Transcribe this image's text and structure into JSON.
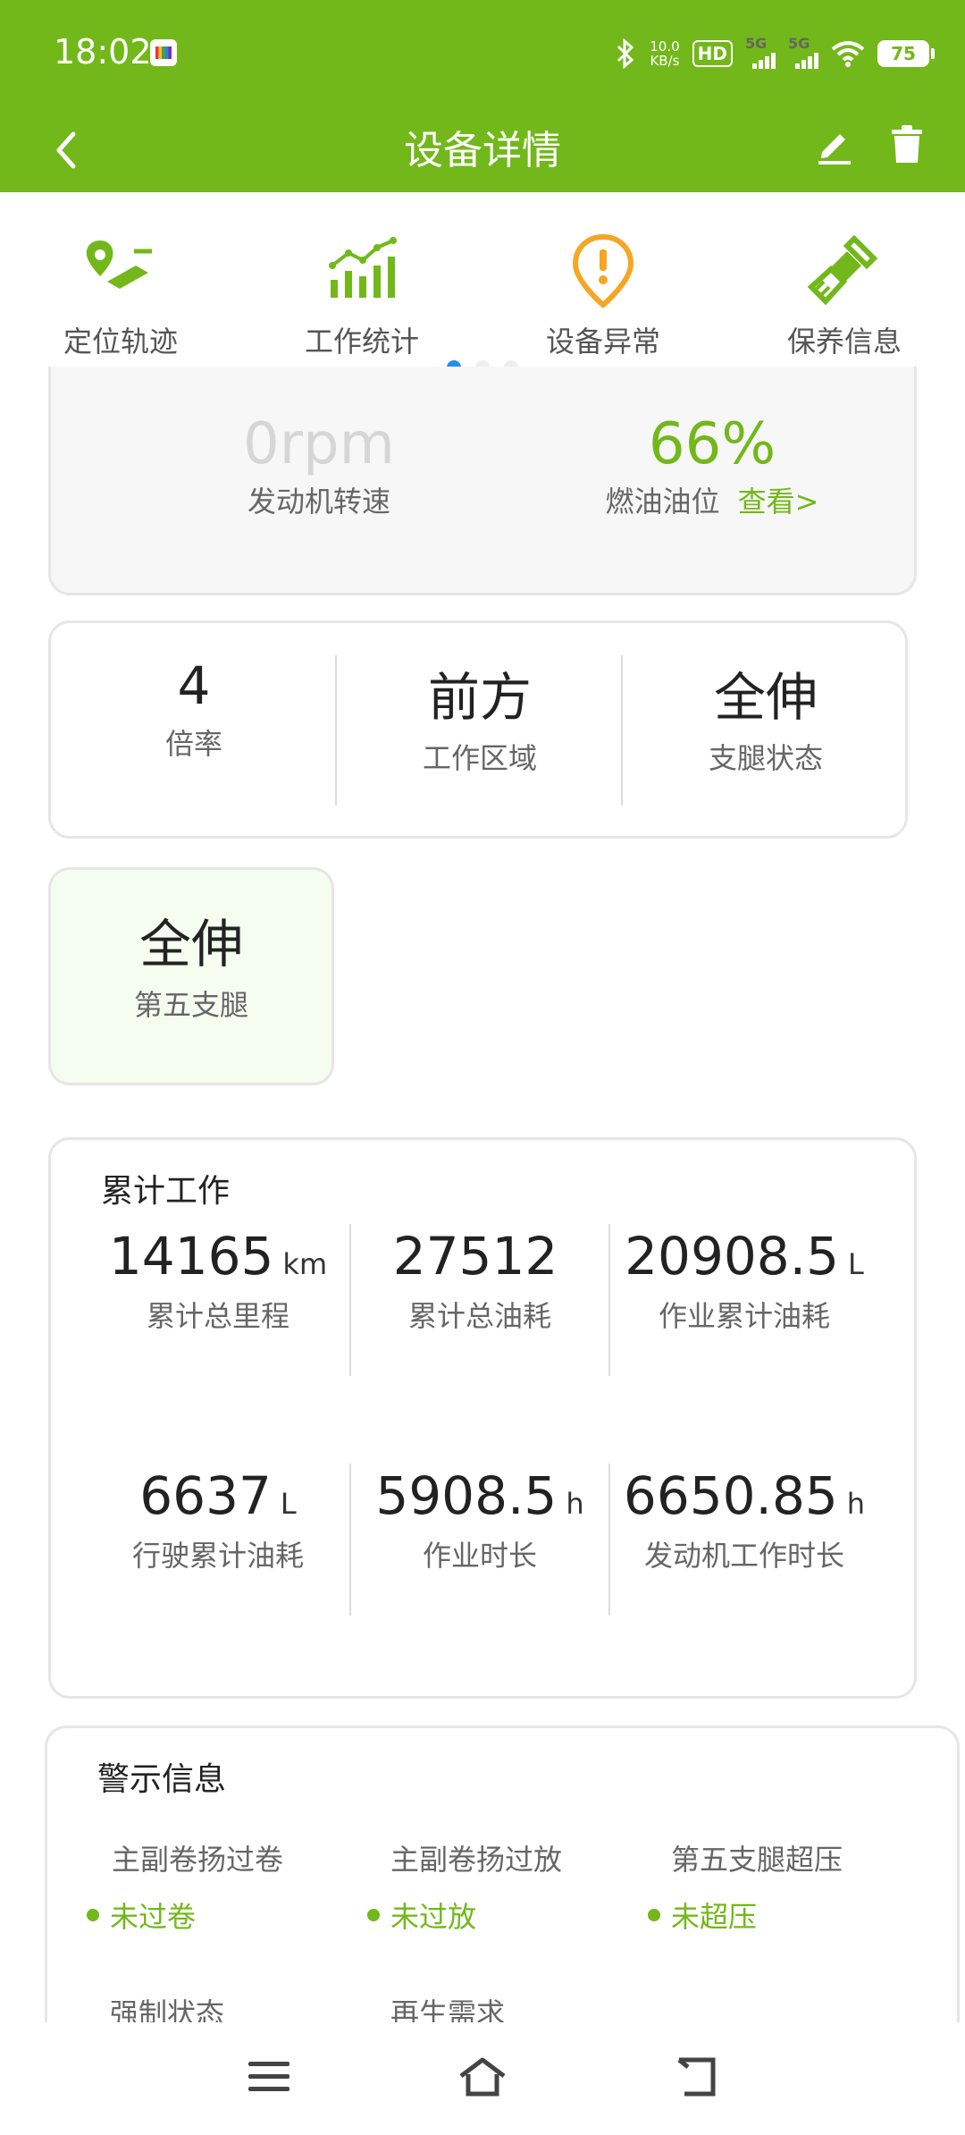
{
  "status_bar": {
    "time": "18:02",
    "net_speed_value": "10.0",
    "net_speed_unit": "KB/s",
    "hd_label": "HD",
    "sig1_label": "5G",
    "sig2_label": "5G",
    "battery": "75"
  },
  "header": {
    "title": "设备详情"
  },
  "quick_menu": [
    {
      "label": "定位轨迹",
      "icon": "location-track-icon"
    },
    {
      "label": "工作统计",
      "icon": "statistics-chart-icon"
    },
    {
      "label": "设备异常",
      "icon": "alert-pin-icon"
    },
    {
      "label": "保养信息",
      "icon": "maintenance-brush-icon"
    }
  ],
  "engine_card": {
    "rpm_value": "0rpm",
    "rpm_label": "发动机转速",
    "fuel_value": "66%",
    "fuel_label": "燃油油位",
    "fuel_link": "查看>"
  },
  "status_card": [
    {
      "value": "4",
      "label": "倍率"
    },
    {
      "value": "前方",
      "label": "工作区域"
    },
    {
      "value": "全伸",
      "label": "支腿状态"
    }
  ],
  "fifth_leg": {
    "value": "全伸",
    "label": "第五支腿"
  },
  "cumulative": {
    "title": "累计工作",
    "items": [
      {
        "value": "14165",
        "unit": "km",
        "label": "累计总里程"
      },
      {
        "value": "27512",
        "unit": "",
        "label": "累计总油耗"
      },
      {
        "value": "20908.5",
        "unit": "L",
        "label": "作业累计油耗"
      },
      {
        "value": "6637",
        "unit": "L",
        "label": "行驶累计油耗"
      },
      {
        "value": "5908.5",
        "unit": "h",
        "label": "作业时长"
      },
      {
        "value": "6650.85",
        "unit": "h",
        "label": "发动机工作时长"
      }
    ]
  },
  "warnings": {
    "title": "警示信息",
    "items": [
      {
        "label": "主副卷扬过卷",
        "value": "未过卷"
      },
      {
        "label": "主副卷扬过放",
        "value": "未过放"
      },
      {
        "label": "第五支腿超压",
        "value": "未超压"
      },
      {
        "label": "强制状态",
        "value": ""
      },
      {
        "label": "再生需求",
        "value": ""
      }
    ]
  },
  "colors": {
    "brand_green": "#72b81a",
    "alert_orange": "#f5a623",
    "dot_active": "#1f8ef1"
  }
}
